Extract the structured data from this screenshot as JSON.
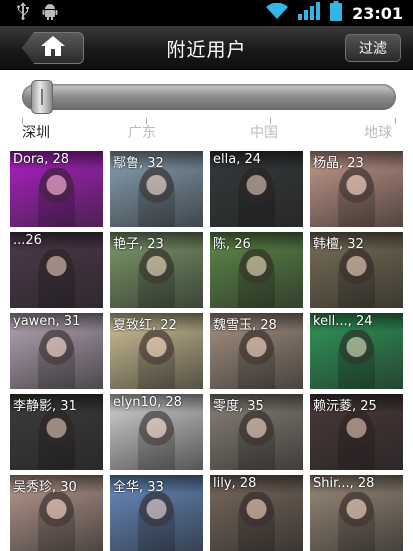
{
  "status_bar": {
    "left_icons": [
      "usb-icon",
      "android-icon"
    ],
    "right_icons": [
      "wifi-icon",
      "signal-icon",
      "battery-icon"
    ],
    "time": "23:01"
  },
  "title_bar": {
    "home_icon": "home-icon",
    "title": "附近用户",
    "filter_label": "过滤"
  },
  "distance_slider": {
    "labels": [
      "深圳",
      "广东",
      "中国",
      "地球"
    ],
    "selected": "深圳",
    "selected_index": 0
  },
  "users": [
    {
      "label": "Dora, 28",
      "color": "#b020c8"
    },
    {
      "label": "鄢鲁, 32",
      "color": "#8aa2b4"
    },
    {
      "label": "ella, 24",
      "color": "#35393b"
    },
    {
      "label": "杨晶, 23",
      "color": "#c69a8c"
    },
    {
      "label": "...26",
      "color": "#4e3a4c"
    },
    {
      "label": "艳子, 23",
      "color": "#7e9a6c"
    },
    {
      "label": "陈, 26",
      "color": "#5f8a4a"
    },
    {
      "label": "韩檀, 32",
      "color": "#7a7058"
    },
    {
      "label": "yawen, 31",
      "color": "#b8a8b8"
    },
    {
      "label": "夏致红, 22",
      "color": "#d2c49a"
    },
    {
      "label": "魏雪玉, 28",
      "color": "#a89484"
    },
    {
      "label": "kell..., 24",
      "color": "#2f9a5a"
    },
    {
      "label": "李静影, 31",
      "color": "#3c3c3c"
    },
    {
      "label": "elyn10, 28",
      "color": "#d6d6d6"
    },
    {
      "label": "零度, 35",
      "color": "#8a8278"
    },
    {
      "label": "赖沅菱, 25",
      "color": "#4a3838"
    },
    {
      "label": "吴秀珍, 30",
      "color": "#b89c90"
    },
    {
      "label": "全华, 33",
      "color": "#6a8ec4"
    },
    {
      "label": "lily, 28",
      "color": "#7a6a5e"
    },
    {
      "label": "Shir..., 28",
      "color": "#9c8c7a"
    }
  ]
}
